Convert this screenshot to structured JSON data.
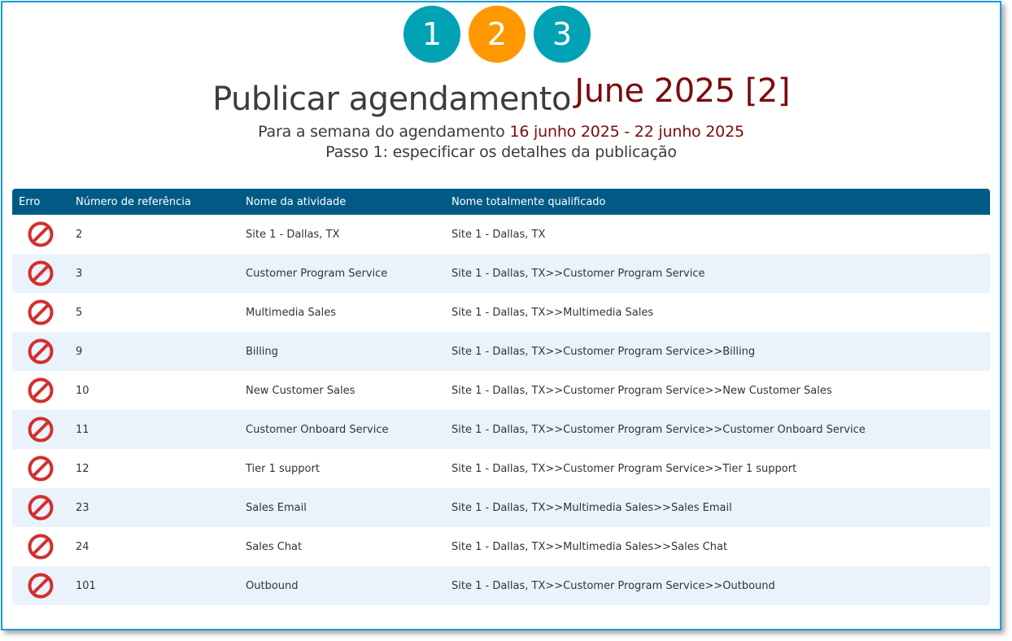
{
  "wizard": {
    "steps": [
      {
        "label": "1",
        "color": "#00a2b4"
      },
      {
        "label": "2",
        "color": "#ff9800"
      },
      {
        "label": "3",
        "color": "#00a2b4"
      }
    ],
    "active_step": "2"
  },
  "header": {
    "title": "Publicar agendamento",
    "schedule_name": "June 2025 [2]",
    "week_prefix": "Para a semana do agendamento",
    "week_range": "16 junho 2025 - 22 junho 2025",
    "step_description": "Passo 1: especificar os detalhes da publicação"
  },
  "colors": {
    "accent_dark_red": "#7b0b0b",
    "table_header_bg": "#005a85",
    "row_alt_bg": "#eaf3fb",
    "error_red": "#d32f2f"
  },
  "table": {
    "columns": [
      "Erro",
      "Número de referência",
      "Nome da atividade",
      "Nome totalmente qualificado"
    ],
    "rows": [
      {
        "icon": "error-prohibited-icon",
        "ref": "2",
        "name": "Site 1 - Dallas, TX",
        "fqn": "Site 1 - Dallas, TX"
      },
      {
        "icon": "error-prohibited-icon",
        "ref": "3",
        "name": "Customer Program Service",
        "fqn": "Site 1 - Dallas, TX>>Customer Program Service"
      },
      {
        "icon": "error-prohibited-icon",
        "ref": "5",
        "name": "Multimedia Sales",
        "fqn": "Site 1 - Dallas, TX>>Multimedia Sales"
      },
      {
        "icon": "error-prohibited-icon",
        "ref": "9",
        "name": "Billing",
        "fqn": "Site 1 - Dallas, TX>>Customer Program Service>>Billing"
      },
      {
        "icon": "error-prohibited-icon",
        "ref": "10",
        "name": "New Customer Sales",
        "fqn": "Site 1 - Dallas, TX>>Customer Program Service>>New Customer Sales"
      },
      {
        "icon": "error-prohibited-icon",
        "ref": "11",
        "name": "Customer Onboard Service",
        "fqn": "Site 1 - Dallas, TX>>Customer Program Service>>Customer Onboard Service"
      },
      {
        "icon": "error-prohibited-icon",
        "ref": "12",
        "name": "Tier 1 support",
        "fqn": "Site 1 - Dallas, TX>>Customer Program Service>>Tier 1 support"
      },
      {
        "icon": "error-prohibited-icon",
        "ref": "23",
        "name": "Sales Email",
        "fqn": "Site 1 - Dallas, TX>>Multimedia Sales>>Sales Email"
      },
      {
        "icon": "error-prohibited-icon",
        "ref": "24",
        "name": "Sales Chat",
        "fqn": "Site 1 - Dallas, TX>>Multimedia Sales>>Sales Chat"
      },
      {
        "icon": "error-prohibited-icon",
        "ref": "101",
        "name": "Outbound",
        "fqn": "Site 1 - Dallas, TX>>Customer Program Service>>Outbound"
      }
    ]
  }
}
